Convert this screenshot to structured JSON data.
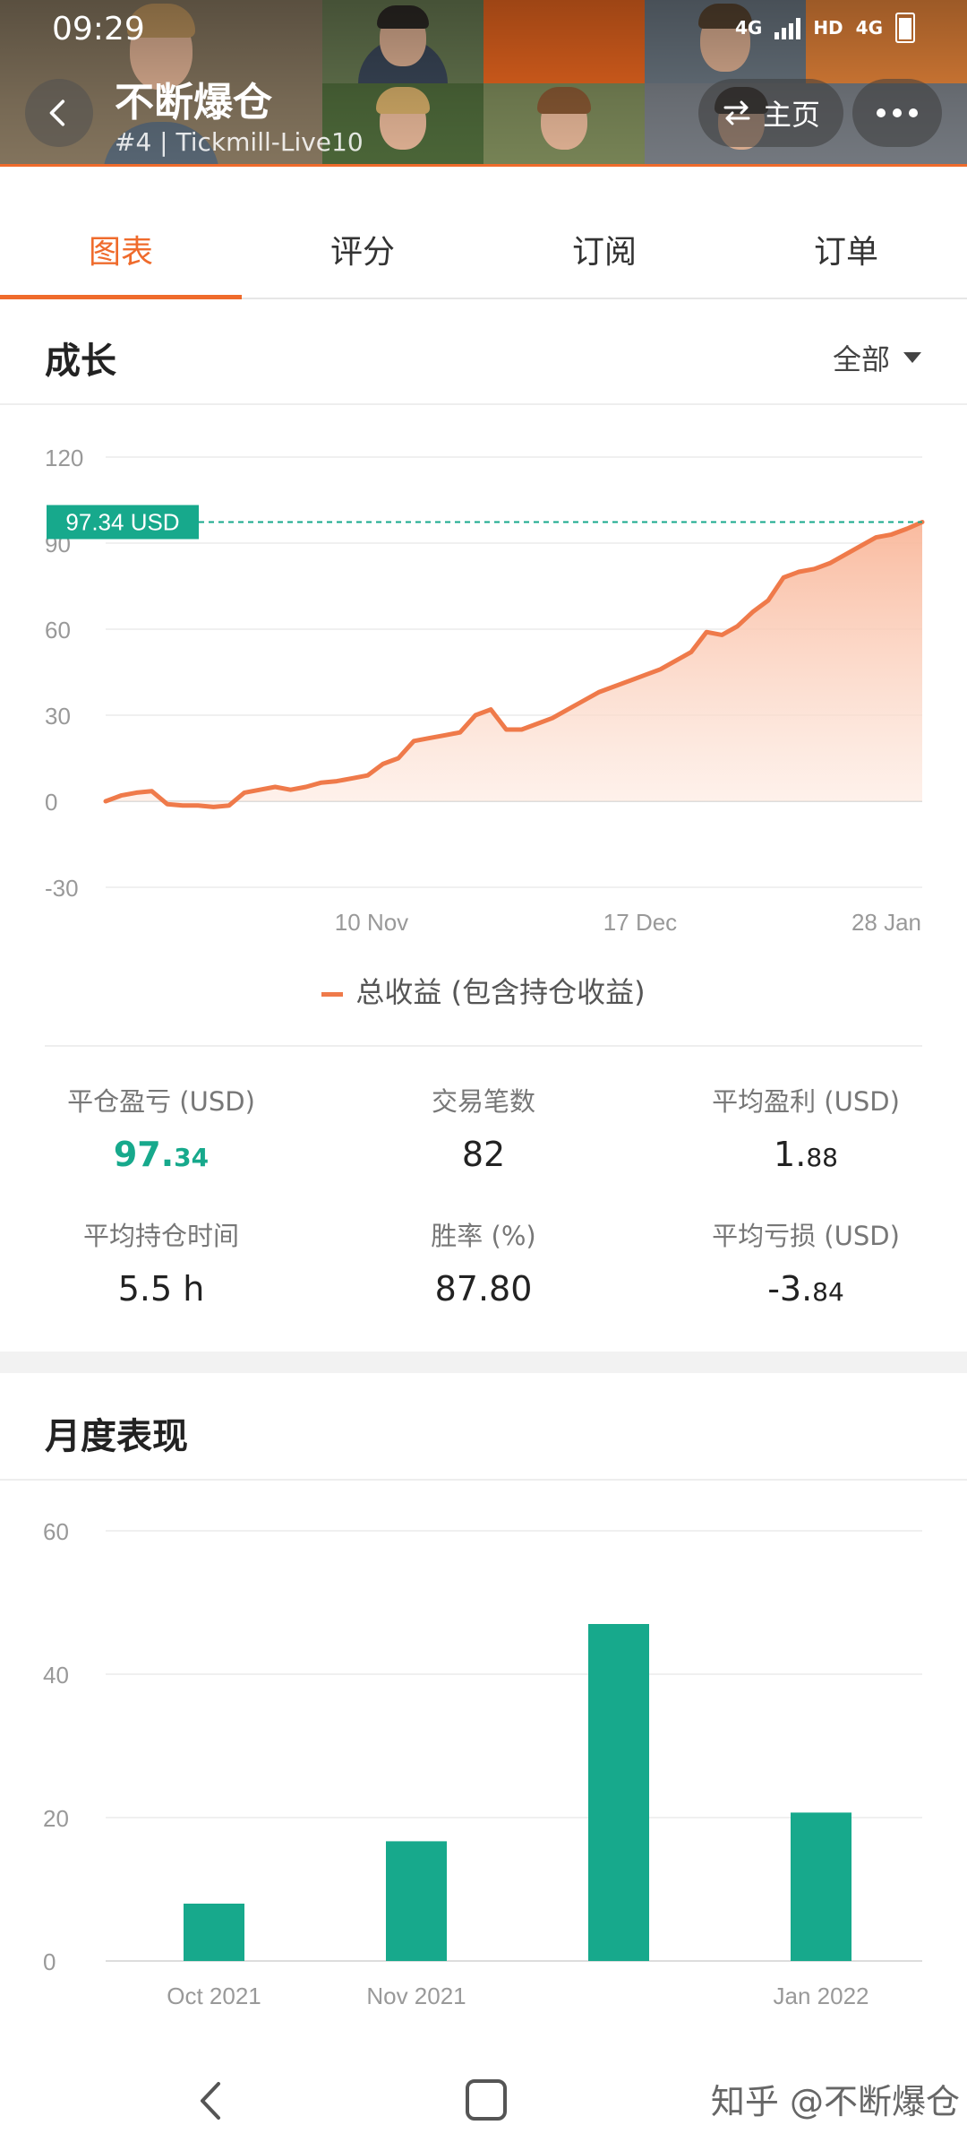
{
  "status_bar": {
    "time": "09:29",
    "network_1": "4G",
    "hd": "HD",
    "network_2": "4G"
  },
  "header": {
    "title": "不断爆仓",
    "subtitle": "#4 | Tickmill-Live10",
    "home_label": "主页",
    "photo_tiles": [
      "person-photo",
      "person-photo",
      "orange-pattern",
      "person-photo",
      "person-photo",
      "person-photo",
      "person-photo",
      "person-photo"
    ]
  },
  "tabs": [
    {
      "label": "图表",
      "active": true
    },
    {
      "label": "评分",
      "active": false
    },
    {
      "label": "订阅",
      "active": false
    },
    {
      "label": "订单",
      "active": false
    }
  ],
  "growth": {
    "title": "成长",
    "filter_label": "全部",
    "current_value_label": "97.34 USD",
    "legend": "总收益 (包含持仓收益)"
  },
  "stats": [
    {
      "label": "平仓盈亏 (USD)",
      "int": "97.",
      "dec": "34",
      "highlight": true
    },
    {
      "label": "交易笔数",
      "int": "82",
      "dec": "",
      "highlight": false
    },
    {
      "label": "平均盈利 (USD)",
      "int": "1.",
      "dec": "88",
      "highlight": false
    },
    {
      "label": "平均持仓时间",
      "int": "5.5 h",
      "dec": "",
      "highlight": false
    },
    {
      "label": "胜率 (%)",
      "int": "87.80",
      "dec": "",
      "highlight": false
    },
    {
      "label": "平均亏损 (USD)",
      "int": "-3.",
      "dec": "84",
      "highlight": false
    }
  ],
  "monthly": {
    "title": "月度表现"
  },
  "chart_data": [
    {
      "type": "area",
      "title": "成长",
      "x_ticks": [
        "10 Nov",
        "17 Dec",
        "28 Jan"
      ],
      "y_ticks": [
        120,
        90,
        60,
        30,
        0,
        -30
      ],
      "ylim": [
        -30,
        120
      ],
      "series": [
        {
          "name": "总收益 (包含持仓收益)",
          "values": [
            0,
            2,
            3,
            3.5,
            -1,
            -1.5,
            -1.5,
            -2,
            -1.5,
            3,
            4,
            5,
            4,
            5,
            6.5,
            7,
            8,
            9,
            13,
            15,
            21,
            22,
            23,
            24,
            30,
            32,
            25,
            25,
            27,
            29,
            32,
            35,
            38,
            40,
            42,
            44,
            46,
            49,
            52,
            59,
            58,
            61,
            66,
            70,
            78,
            80,
            81,
            83,
            86,
            89,
            92,
            93,
            95,
            97.34
          ]
        }
      ],
      "reference_line": 97.34,
      "colors": {
        "line": "#ef7a4a",
        "fill": "#fbd3c0",
        "ref": "#17a98c"
      }
    },
    {
      "type": "bar",
      "title": "月度表现",
      "categories": [
        "Oct 2021",
        "Nov 2021",
        "",
        "Jan 2022"
      ],
      "values": [
        8,
        16.7,
        47,
        20.7
      ],
      "y_ticks": [
        60,
        40,
        20,
        0
      ],
      "ylim": [
        0,
        60
      ],
      "colors": {
        "bar": "#17a98c"
      }
    }
  ],
  "watermark": "知乎 @不断爆仓"
}
